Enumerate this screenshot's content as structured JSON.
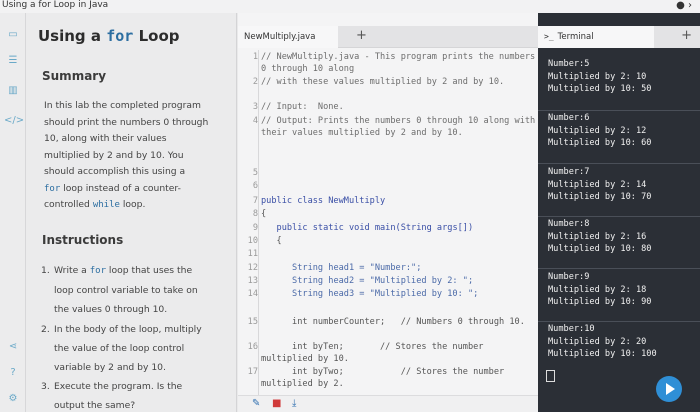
{
  "window": {
    "title": "Using a for Loop in Java",
    "controls": [
      "●",
      "›"
    ]
  },
  "lesson": {
    "title_pre": "Using a",
    "title_code": "for",
    "title_post": "Loop",
    "summary_heading": "Summary",
    "summary_l1": "In this lab the completed program",
    "summary_l2": "should print the numbers 0 through",
    "summary_l3": "10, along with their values",
    "summary_l4": "multiplied by 2 and by 10. You",
    "summary_l5": "should accomplish this using a",
    "summary_l6_code": "for",
    "summary_l6_rest": "loop instead of a counter-",
    "summary_l7_pre": "controlled",
    "summary_l7_code": "while",
    "summary_l7_post": "loop.",
    "instructions_heading": "Instructions",
    "step1_num": "1.",
    "step1_pre": "Write a",
    "step1_code": "for",
    "step1_l1_post": "loop that uses the",
    "step1_l2": "loop control variable to take on",
    "step1_l3": "the values 0 through 10.",
    "step2_num": "2.",
    "step2_l1": "In the body of the loop, multiply",
    "step2_l2": "the value of the loop control",
    "step2_l3": "variable by 2 and by 10.",
    "step3_num": "3.",
    "step3_l1": "Execute the program. Is the",
    "step3_l2": "output the same?"
  },
  "editor": {
    "tab_label": "NewMultiply.java",
    "add_tab": "+",
    "lines": [
      {
        "n": "1",
        "text": "// NewMultiply.java - This program prints the numbers 0 through 10 along"
      },
      {
        "n": "2",
        "text": "// with these values multiplied by 2 and by 10."
      },
      {
        "n": "3",
        "text": "// Input:  None."
      },
      {
        "n": "4",
        "text": "// Output: Prints the numbers 0 through 10 along with their values multiplied by 2 and by 10."
      },
      {
        "n": "5",
        "text": ""
      },
      {
        "n": "6",
        "text": ""
      },
      {
        "n": "7",
        "text": "public class NewMultiply"
      },
      {
        "n": "8",
        "text": "{"
      },
      {
        "n": "9",
        "text": "   public static void main(String args[])"
      },
      {
        "n": "10",
        "text": "   {"
      },
      {
        "n": "11",
        "text": ""
      },
      {
        "n": "12",
        "text": "      String head1 = \"Number:\";"
      },
      {
        "n": "13",
        "text": "      String head2 = \"Multiplied by 2: \";"
      },
      {
        "n": "14",
        "text": "      String head3 = \"Multiplied by 10: \";"
      },
      {
        "n": "15",
        "text": "      int numberCounter;   // Numbers 0 through 10."
      },
      {
        "n": "16",
        "text": "      int byTen;       // Stores the number multiplied by 10."
      },
      {
        "n": "17",
        "text": "      int byTwo;           // Stores the number multiplied by 2."
      }
    ],
    "bottom_icons": [
      "✎",
      "■",
      "⤓"
    ]
  },
  "terminal": {
    "tab_label": "Terminal",
    "prompt_icon": ">_",
    "add_tab": "+",
    "blocks": [
      {
        "num": "Number:5",
        "by2": "Multiplied by 2: 10",
        "by10": "Multiplied by 10: 50"
      },
      {
        "num": "Number:6",
        "by2": "Multiplied by 2: 12",
        "by10": "Multiplied by 10: 60"
      },
      {
        "num": "Number:7",
        "by2": "Multiplied by 2: 14",
        "by10": "Multiplied by 10: 70"
      },
      {
        "num": "Number:8",
        "by2": "Multiplied by 2: 16",
        "by10": "Multiplied by 10: 80"
      },
      {
        "num": "Number:9",
        "by2": "Multiplied by 2: 18",
        "by10": "Multiplied by 10: 90"
      },
      {
        "num": "Number:10",
        "by2": "Multiplied by 2: 20",
        "by10": "Multiplied by 10: 100"
      }
    ]
  },
  "rail_icons": [
    "book-icon",
    "list-icon",
    "chart-icon",
    "code-icon"
  ],
  "rail_icons_bottom": [
    "share-icon",
    "help-icon",
    "settings-icon"
  ],
  "colors": {
    "accent": "#2f8fd6",
    "terminal_bg": "#2b2f36",
    "code_keyword": "#3a4fa6"
  }
}
